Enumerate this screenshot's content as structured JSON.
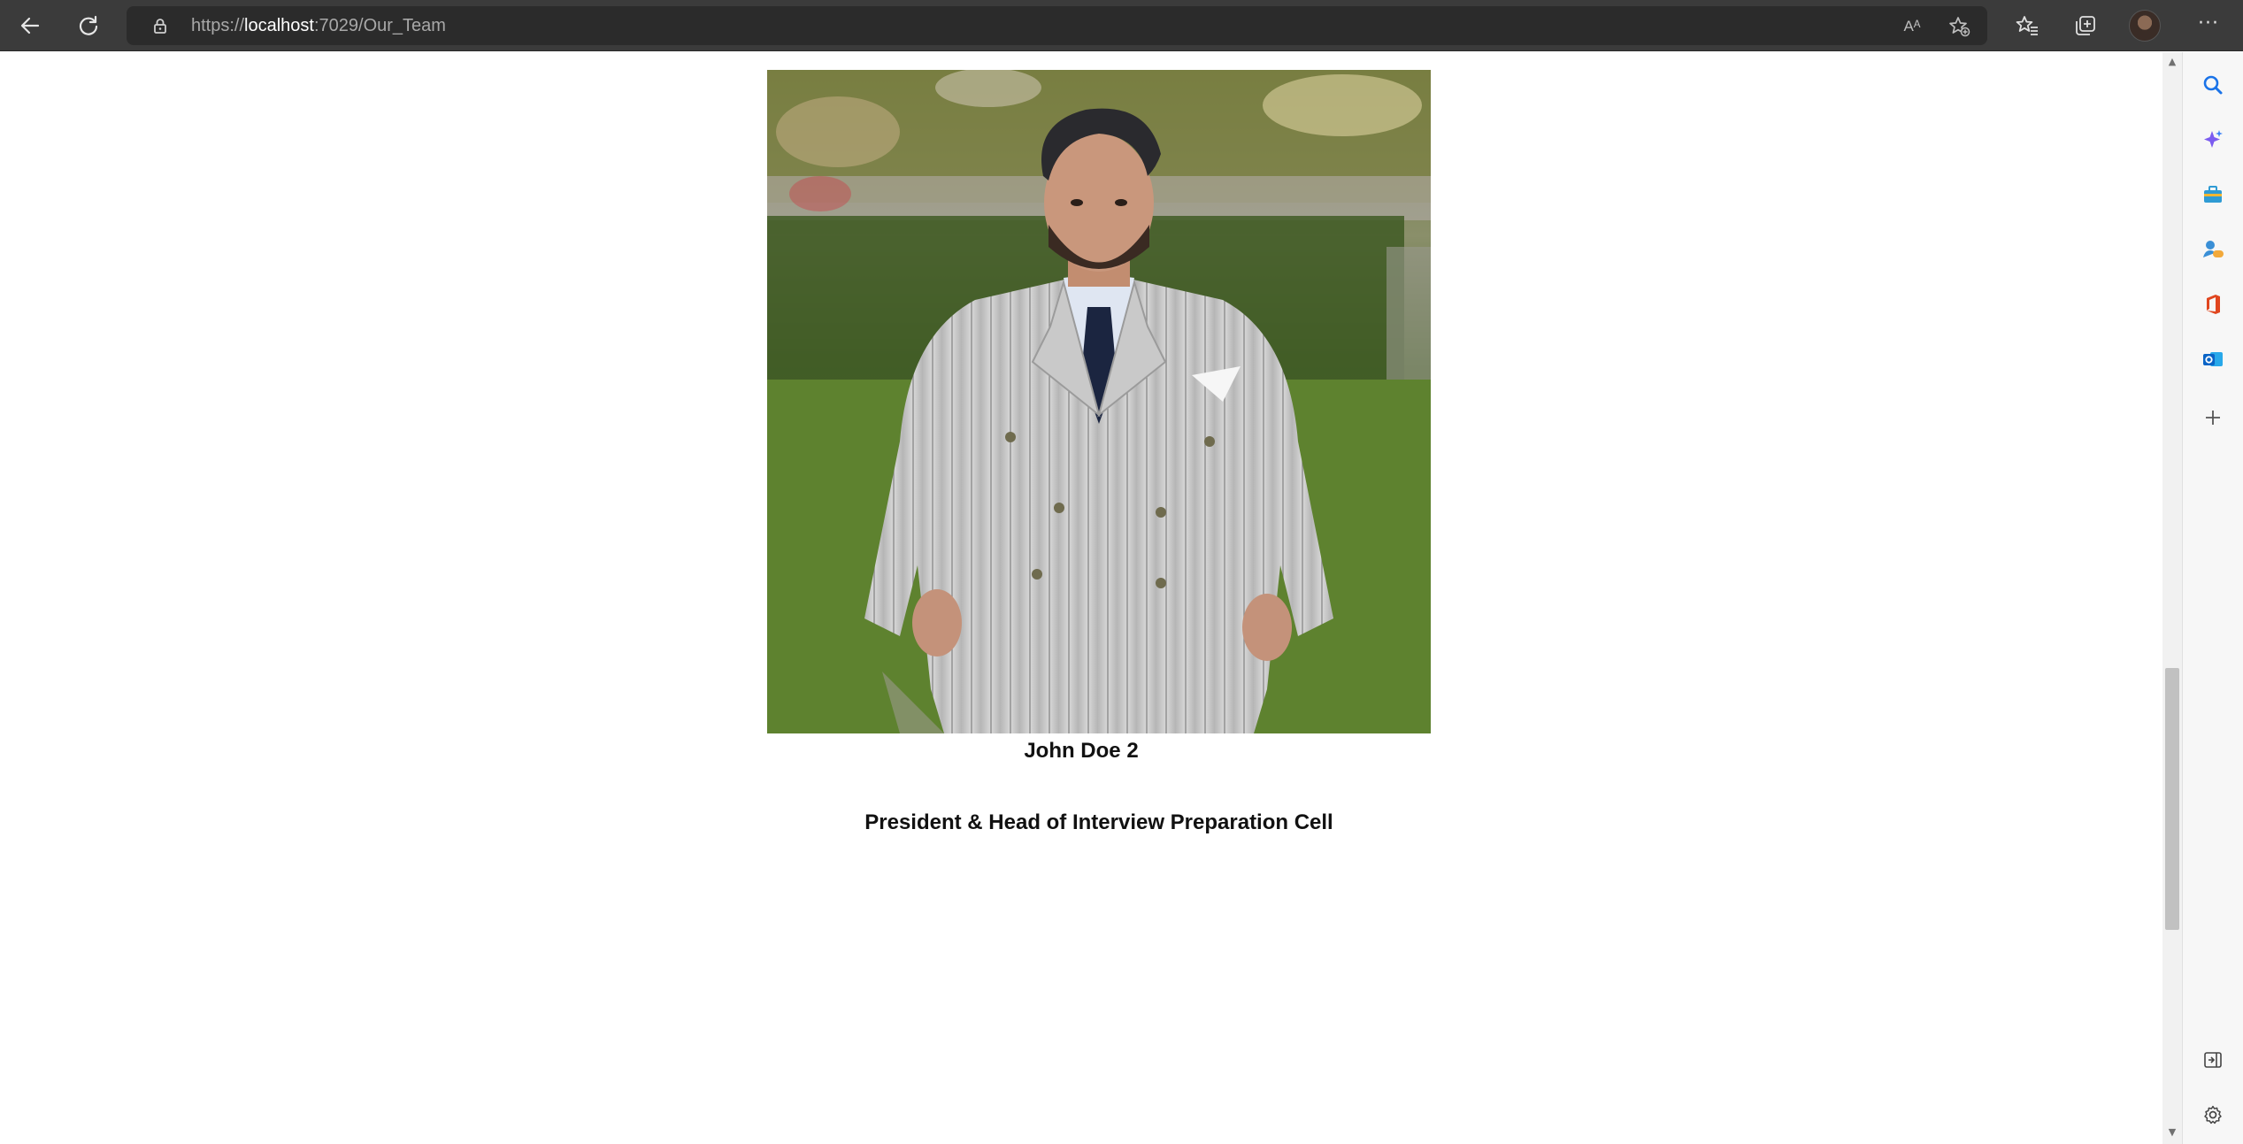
{
  "browser": {
    "url_scheme": "https://",
    "url_host": "localhost",
    "url_path": ":7029/Our_Team",
    "read_aloud_label": "Aᴬ"
  },
  "toolbar_icons": [
    "back-icon",
    "refresh-icon",
    "lock-icon",
    "read-aloud-icon",
    "add-favorite-icon",
    "favorites-icon",
    "collections-icon",
    "profile-avatar",
    "more-icon"
  ],
  "sidebar_icons": [
    "search-icon",
    "copilot-icon",
    "tools-icon",
    "games-icon",
    "office-icon",
    "outlook-icon",
    "add-icon",
    "hide-sidebar-icon",
    "settings-icon"
  ],
  "colors": {
    "toolbar_bg": "#3b3b3b",
    "urlbar_bg": "#2b2b2b",
    "sidebar_bg": "#f7f7f7",
    "copilot": "#7b5cf0",
    "office": "#e0461f",
    "outlook": "#0a64c6",
    "search": "#1a73e8"
  },
  "member": {
    "name": "John Doe 2",
    "role": "President & Head of Interview Preparation Cell"
  },
  "scroll": {
    "position_fraction": 0.53
  }
}
